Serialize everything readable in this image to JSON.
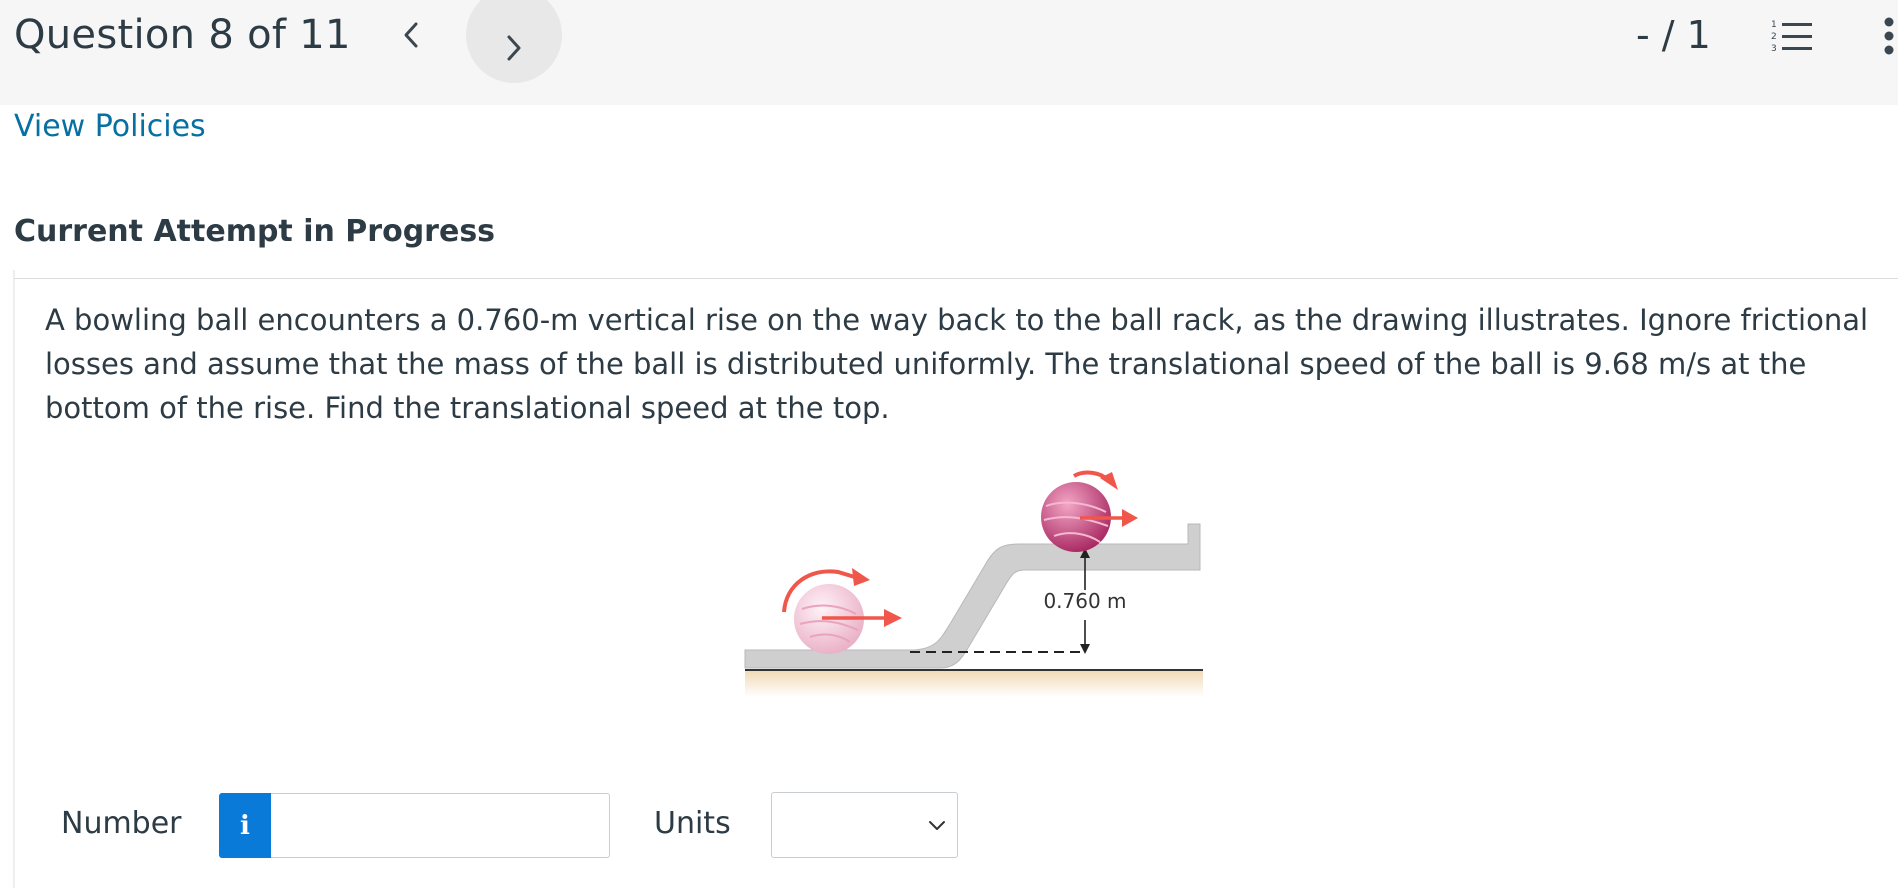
{
  "header": {
    "question_title": "Question 8 of 11",
    "score": "- / 1",
    "list_icon_digits": [
      "1",
      "2",
      "3"
    ]
  },
  "links": {
    "view_policies": "View Policies"
  },
  "section": {
    "attempt_heading": "Current Attempt in Progress"
  },
  "question": {
    "text": "A bowling ball encounters a 0.760-m vertical rise on the way back to the ball rack, as the drawing illustrates. Ignore frictional losses and assume that the mass of the ball is distributed uniformly. The translational speed of the ball is 9.68 m/s at the bottom of the rise. Find the translational speed at the top."
  },
  "figure": {
    "height_label": "0.760 m",
    "colors": {
      "ball_bottom": "#f3c4d6",
      "ball_top": "#c9437e",
      "arrow": "#f0564a",
      "track": "#cfcfcf",
      "floor": "#f0d7b0"
    }
  },
  "answer": {
    "number_label": "Number",
    "info_glyph": "i",
    "number_value": "",
    "units_label": "Units",
    "units_selected": ""
  },
  "colors": {
    "link": "#0770a3",
    "info_button": "#0a7ad9",
    "header_bg": "#f6f6f6",
    "text": "#2d3b45"
  }
}
